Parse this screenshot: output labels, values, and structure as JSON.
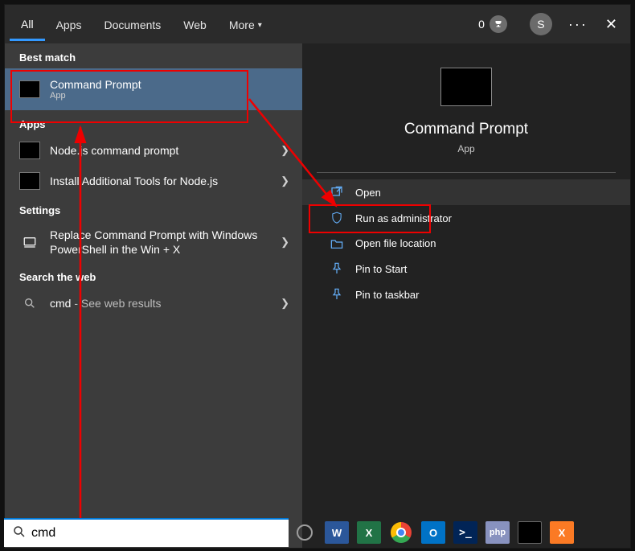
{
  "tabs": {
    "all": "All",
    "apps": "Apps",
    "documents": "Documents",
    "web": "Web",
    "more": "More"
  },
  "rewards_count": "0",
  "avatar_letter": "S",
  "sections": {
    "best_match": "Best match",
    "apps": "Apps",
    "settings": "Settings",
    "search_web": "Search the web"
  },
  "best_match": {
    "title": "Command Prompt",
    "subtitle": "App"
  },
  "apps_list": [
    {
      "title": "Node.js command prompt"
    },
    {
      "title": "Install Additional Tools for Node.js"
    }
  ],
  "settings_list": [
    {
      "title": "Replace Command Prompt with Windows PowerShell in the Win + X"
    }
  ],
  "web_list": {
    "query": "cmd",
    "suffix": " - See web results"
  },
  "details": {
    "title": "Command Prompt",
    "subtitle": "App",
    "actions": {
      "open": "Open",
      "run_admin": "Run as administrator",
      "open_location": "Open file location",
      "pin_start": "Pin to Start",
      "pin_taskbar": "Pin to taskbar"
    }
  },
  "search": {
    "value": "cmd"
  },
  "taskbar": {
    "word": "W",
    "excel": "X",
    "outlook": "O",
    "ps": ">_",
    "php": "php",
    "xampp": "X"
  }
}
